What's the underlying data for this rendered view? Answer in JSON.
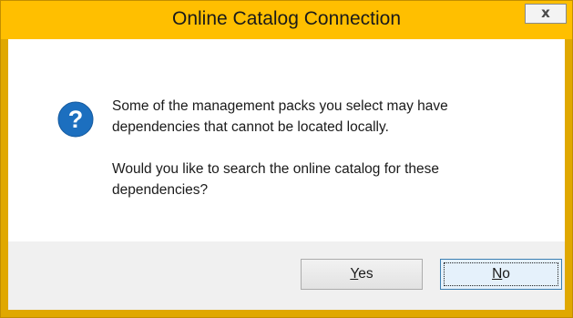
{
  "window": {
    "title": "Online Catalog Connection",
    "close_glyph": "x",
    "close_icon": "close-icon"
  },
  "message": {
    "icon": "question-icon",
    "icon_glyph": "?",
    "line1": "Some of the management packs you select may have dependencies that cannot be located locally.",
    "line2": "Would you like to search the online catalog for these dependencies?"
  },
  "buttons": {
    "yes": {
      "accel": "Y",
      "rest": "es"
    },
    "no": {
      "accel": "N",
      "rest": "o"
    }
  },
  "colors": {
    "titlebar": "#ffbf00",
    "frame": "#e0a800",
    "icon_blue": "#1c6fbf"
  }
}
